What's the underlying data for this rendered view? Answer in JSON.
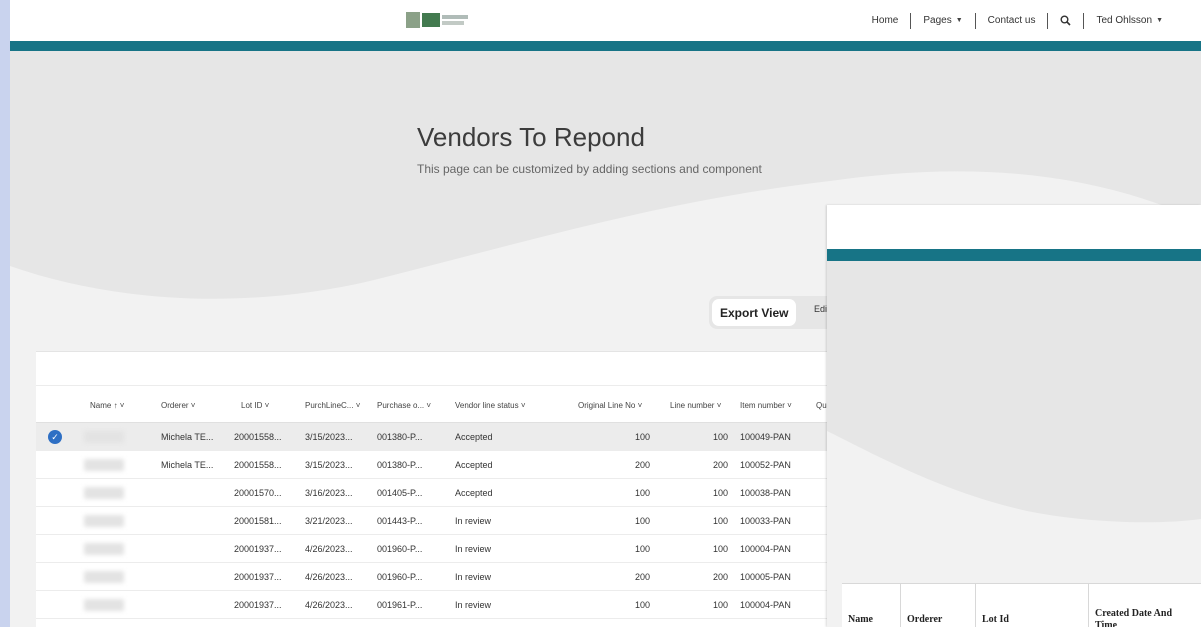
{
  "header": {
    "logo_icon": "company-logo",
    "nav": [
      {
        "label": "Home",
        "caret": false
      },
      {
        "label": "Pages",
        "caret": true
      },
      {
        "label": "Contact us",
        "caret": false
      },
      {
        "label": "",
        "icon": "search-icon"
      },
      {
        "label": "Ted Ohlsson",
        "caret": true
      }
    ]
  },
  "hero": {
    "title": "Vendors To Repond",
    "subtitle": "This page can be customized by adding sections and component"
  },
  "toolbar": {
    "export_label": "Export View",
    "edit_label": "Edi"
  },
  "grid": {
    "columns": [
      "Name ↑ ˅",
      "Orderer ˅",
      "Lot ID ˅",
      "PurchLineC... ˅",
      "Purchase o... ˅",
      "Vendor line status ˅",
      "Original Line No ˅",
      "Line number ˅",
      "Item number ˅",
      "Quan"
    ],
    "rows": [
      {
        "selected": true,
        "orderer": "Michela TE...",
        "lot": "20001558...",
        "date": "3/15/2023...",
        "po": "001380-P...",
        "status": "Accepted",
        "orig": "100",
        "line": "100",
        "item": "100049-PAN"
      },
      {
        "selected": false,
        "orderer": "Michela TE...",
        "lot": "20001558...",
        "date": "3/15/2023...",
        "po": "001380-P...",
        "status": "Accepted",
        "orig": "200",
        "line": "200",
        "item": "100052-PAN"
      },
      {
        "selected": false,
        "orderer": "",
        "lot": "20001570...",
        "date": "3/16/2023...",
        "po": "001405-P...",
        "status": "Accepted",
        "orig": "100",
        "line": "100",
        "item": "100038-PAN"
      },
      {
        "selected": false,
        "orderer": "",
        "lot": "20001581...",
        "date": "3/21/2023...",
        "po": "001443-P...",
        "status": "In review",
        "orig": "100",
        "line": "100",
        "item": "100033-PAN"
      },
      {
        "selected": false,
        "orderer": "",
        "lot": "20001937...",
        "date": "4/26/2023...",
        "po": "001960-P...",
        "status": "In review",
        "orig": "100",
        "line": "100",
        "item": "100004-PAN"
      },
      {
        "selected": false,
        "orderer": "",
        "lot": "20001937...",
        "date": "4/26/2023...",
        "po": "001960-P...",
        "status": "In review",
        "orig": "200",
        "line": "200",
        "item": "100005-PAN"
      },
      {
        "selected": false,
        "orderer": "",
        "lot": "20001937...",
        "date": "4/26/2023...",
        "po": "001961-P...",
        "status": "In review",
        "orig": "100",
        "line": "100",
        "item": "100004-PAN"
      }
    ]
  },
  "overlay_table": {
    "columns": [
      "Name",
      "Orderer",
      "Lot Id",
      "Created Date And Time"
    ]
  },
  "colors": {
    "teal": "#177486",
    "accent_blue": "#2e6fc4"
  }
}
